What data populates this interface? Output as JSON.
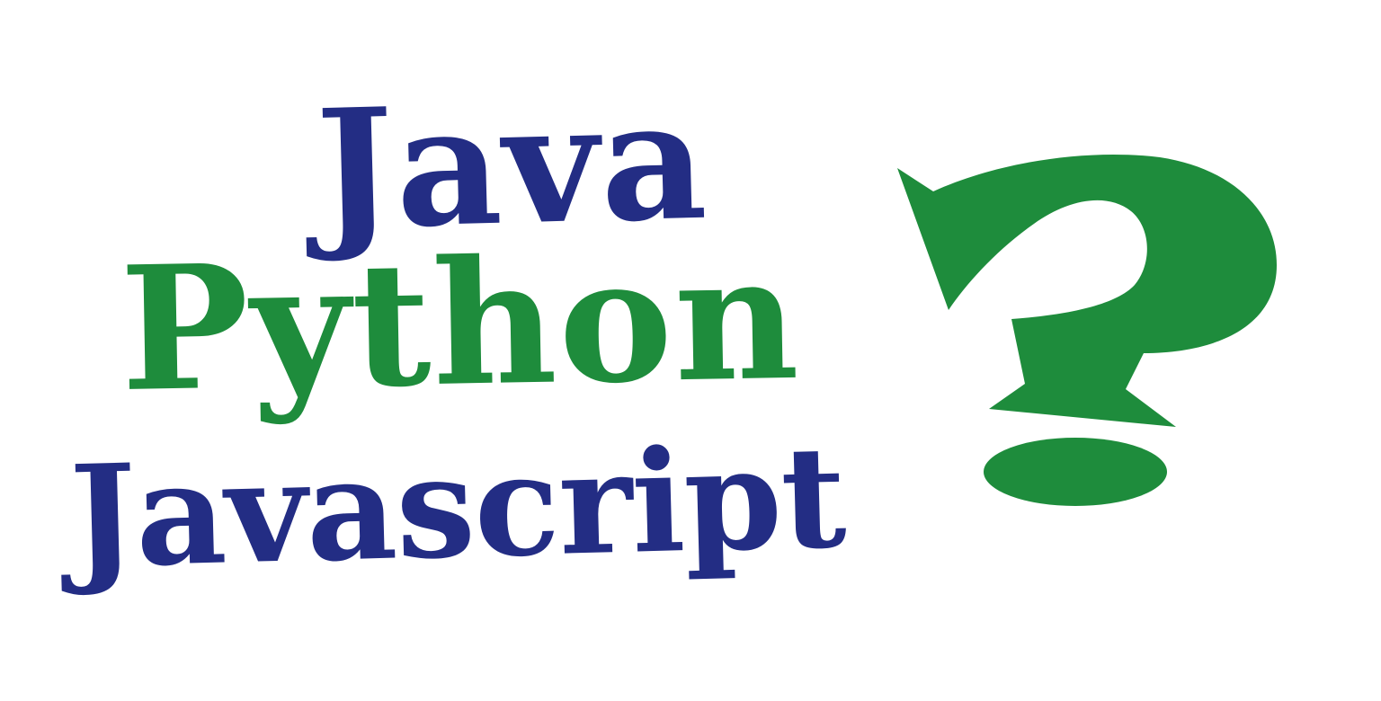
{
  "words": {
    "java": "Java",
    "python": "Python",
    "javascript": "Javascript"
  },
  "icons": {
    "question_mark": "question-mark-icon"
  },
  "colors": {
    "blue": "#232d84",
    "green": "#1e8c3c",
    "background": "#ffffff"
  }
}
